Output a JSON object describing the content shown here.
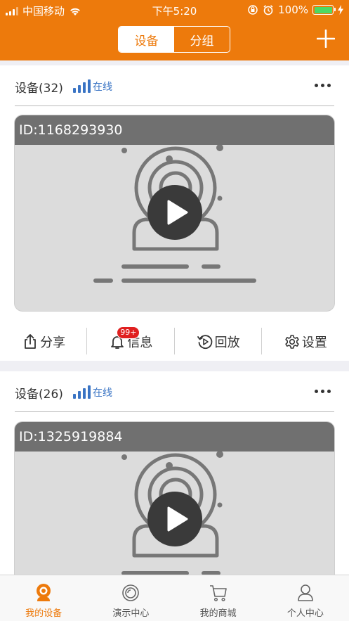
{
  "status_bar": {
    "carrier": "中国移动",
    "time": "下午5:20",
    "battery": "100%"
  },
  "nav": {
    "segments": [
      "设备",
      "分组"
    ],
    "active_segment": 0
  },
  "devices": [
    {
      "name": "设备(32)",
      "status": "在线",
      "id_label": "ID:1168293930",
      "actions": {
        "share": "分享",
        "message": "信息",
        "message_badge": "99+",
        "playback": "回放",
        "settings": "设置"
      }
    },
    {
      "name": "设备(26)",
      "status": "在线",
      "id_label": "ID:1325919884"
    }
  ],
  "tabbar": {
    "items": [
      "我的设备",
      "演示中心",
      "我的商城",
      "个人中心"
    ],
    "active": 0
  },
  "colors": {
    "brand": "#ed7a0c",
    "online": "#3a74c4",
    "badge": "#e02020"
  }
}
